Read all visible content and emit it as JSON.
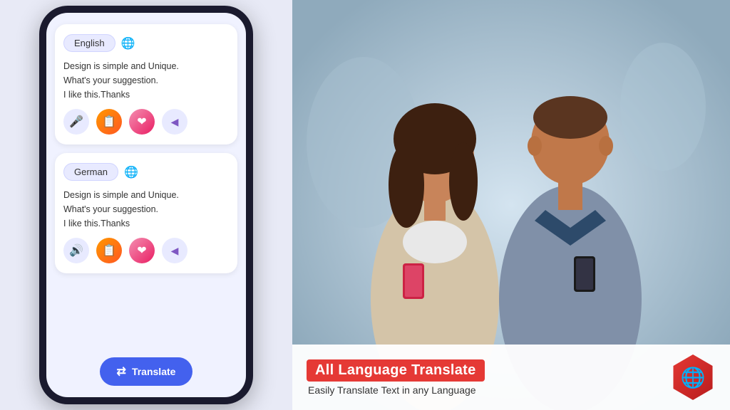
{
  "phone": {
    "card1": {
      "language": "English",
      "text_line1": "Design is simple and Unique.",
      "text_line2": "What's your suggestion.",
      "text_line3": "I like this.Thanks"
    },
    "card2": {
      "language": "German",
      "text_line1": "Design is simple and Unique.",
      "text_line2": "What's your suggestion.",
      "text_line3": "I like this.Thanks"
    },
    "translate_button": "Translate"
  },
  "banner": {
    "title": "All Language Translate",
    "subtitle": "Easily Translate Text in any  Language"
  },
  "icons": {
    "globe": "🌐",
    "mic": "🎤",
    "copy": "📋",
    "heart": "❤",
    "share": "◁",
    "speaker": "🔊",
    "translate_icon": "⇄"
  }
}
